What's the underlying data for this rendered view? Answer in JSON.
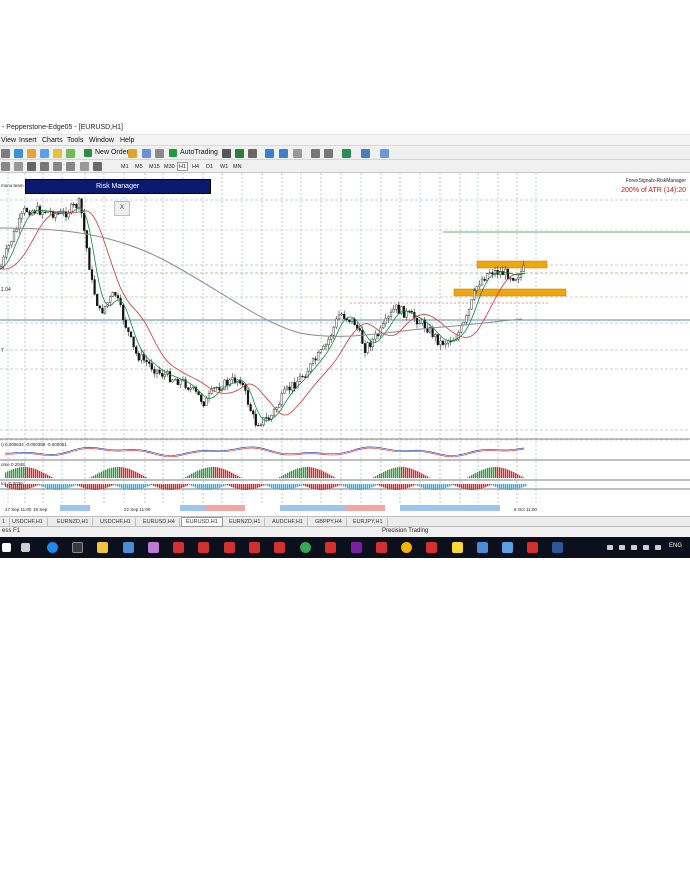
{
  "window": {
    "title": "- Pepperstone-Edge05 - [EURUSD,H1]"
  },
  "menu": [
    "View",
    "Insert",
    "Charts",
    "Tools",
    "Window",
    "Help"
  ],
  "toolbar": {
    "new_order_label": "New Order",
    "autotrading_label": "AutoTrading",
    "timeframes": [
      "M1",
      "M5",
      "M15",
      "M30",
      "H1",
      "H4",
      "D1",
      "W1",
      "MN"
    ],
    "active_timeframe": "H1"
  },
  "chart": {
    "price_labels": {
      "a": "1.04",
      "b": "7"
    },
    "indicator_labels": {
      "macd": "I) 0.000632 -0.000389 -0.000051",
      "ao": "ome 0.2048",
      "ac": "tor -0.0030"
    },
    "left_top_text": "mono.team",
    "time_labels": [
      "17 Sep 11:00",
      "18 Sep",
      "22 Sep 11:00",
      "6 Oct 11:00"
    ],
    "risk_manager_label": "Risk Manager",
    "risk_close_label": "X",
    "atr_indicator_title": "ForexSignals-RiskManager",
    "atr_label": "200% of ATR (14):20",
    "colors": {
      "ma_fast": "#0a8a3a",
      "ma_mid": "#d23232",
      "ma_slow": "#8c8c8c",
      "zone": "#f2a60c",
      "risk_panel": "#0a1a6e",
      "candle": "#111111"
    }
  },
  "tabs": {
    "items": [
      "USDCHF,H1",
      "EURNZD,H1",
      "USDCHF,H1",
      "EURUSD,H4",
      "EURUSD,H1",
      "EURNZD,H1",
      "AUDCHF,H1",
      "GBPPY,H4",
      "EURJPY,H1"
    ],
    "first_partial": "1",
    "active_index": 4
  },
  "status": {
    "left": "ess F1",
    "center": "Precision Trading"
  },
  "taskbar": {
    "lang": "ENG"
  }
}
